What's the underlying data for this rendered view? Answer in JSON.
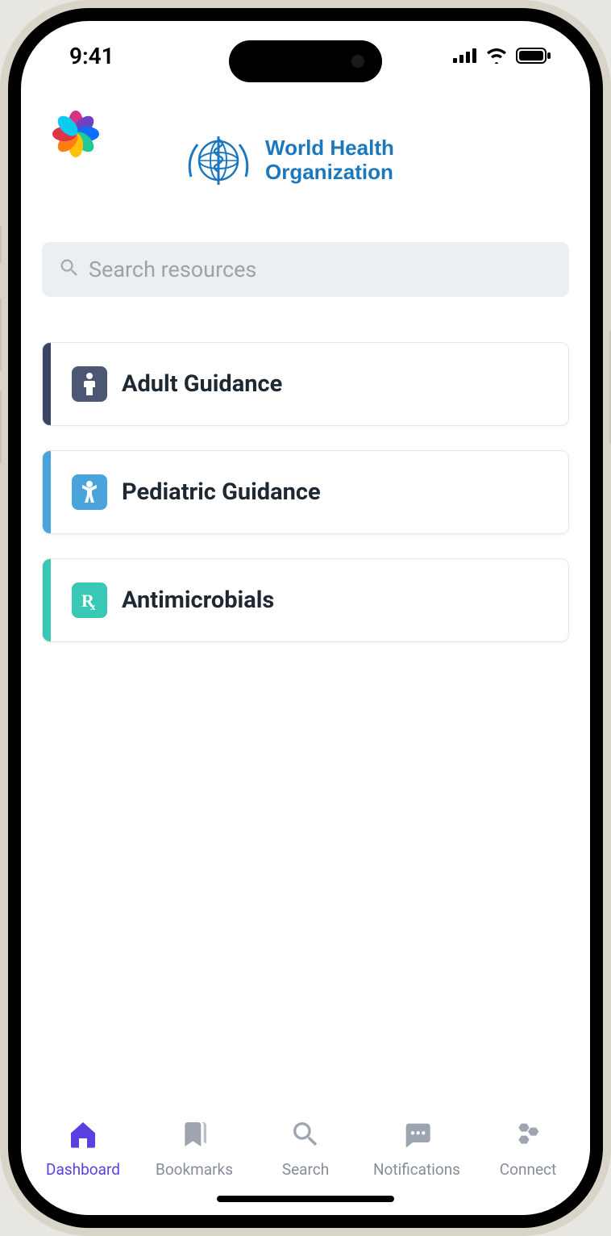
{
  "status": {
    "time": "9:41"
  },
  "header": {
    "org_line1": "World Health",
    "org_line2": "Organization"
  },
  "search": {
    "placeholder": "Search resources"
  },
  "cards": [
    {
      "label": "Adult Guidance",
      "icon": "person-icon",
      "accent": "#3b4563",
      "icon_bg": "#4c5873"
    },
    {
      "label": "Pediatric Guidance",
      "icon": "child-icon",
      "accent": "#4aa3db",
      "icon_bg": "#4aa3db"
    },
    {
      "label": "Antimicrobials",
      "icon": "rx-icon",
      "accent": "#39c8b5",
      "icon_bg": "#39c8b5"
    }
  ],
  "tabs": [
    {
      "label": "Dashboard",
      "icon": "home-icon",
      "active": true
    },
    {
      "label": "Bookmarks",
      "icon": "bookmark-icon",
      "active": false
    },
    {
      "label": "Search",
      "icon": "search-icon",
      "active": false
    },
    {
      "label": "Notifications",
      "icon": "chat-icon",
      "active": false
    },
    {
      "label": "Connect",
      "icon": "hex-icon",
      "active": false
    }
  ]
}
